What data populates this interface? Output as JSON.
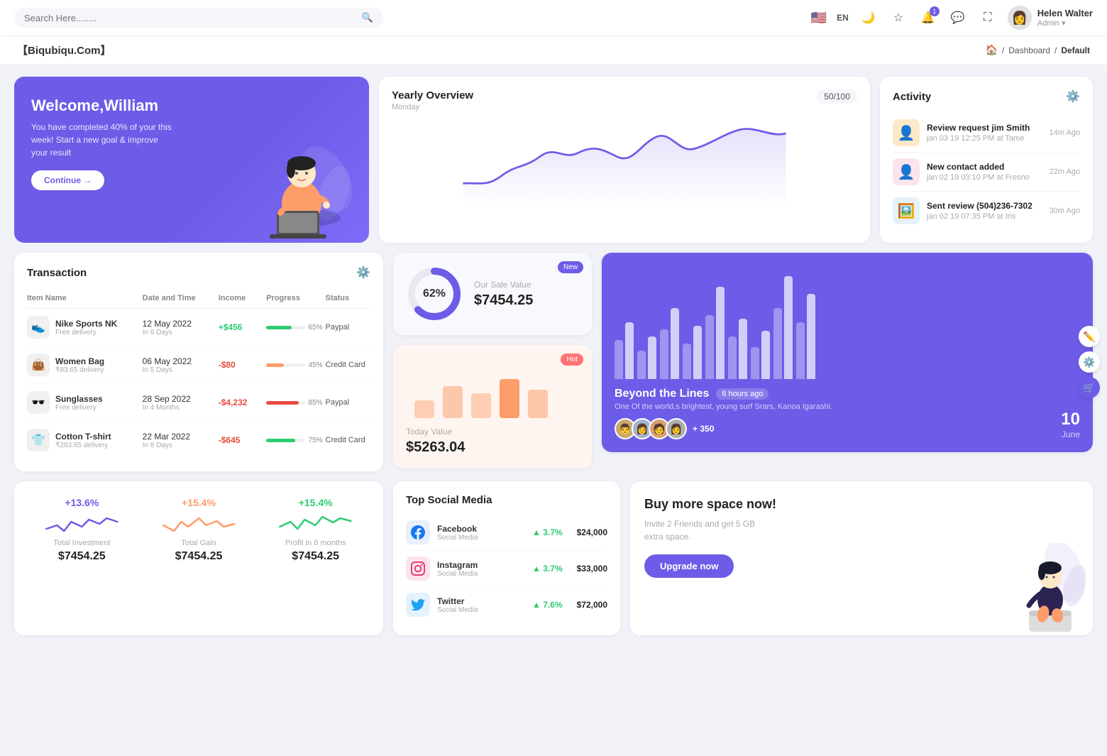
{
  "topnav": {
    "search_placeholder": "Search Here........",
    "lang": "EN",
    "notification_count": "1",
    "user": {
      "name": "Helen Walter",
      "role": "Admin"
    }
  },
  "breadcrumb": {
    "brand": "【Biqubiqu.Com】",
    "home": "🏠",
    "sep1": "/",
    "dashboard": "Dashboard",
    "sep2": "/",
    "current": "Default"
  },
  "welcome": {
    "greeting": "Welcome,William",
    "message": "You have completed 40% of your this week! Start a new goal & improve your result",
    "button": "Continue →"
  },
  "yearly_overview": {
    "title": "Yearly Overview",
    "subtitle": "Monday",
    "badge": "50/100"
  },
  "activity": {
    "title": "Activity",
    "items": [
      {
        "name": "Review request jim Smith",
        "sub": "jan 03 19 12:25 PM at Tame",
        "time": "14m Ago"
      },
      {
        "name": "New contact added",
        "sub": "jan 02 19 03:10 PM at Fresno",
        "time": "22m Ago"
      },
      {
        "name": "Sent review (504)236-7302",
        "sub": "jan 02 19 07:35 PM at Iris",
        "time": "30m Ago"
      }
    ]
  },
  "transaction": {
    "title": "Transaction",
    "columns": [
      "Item Name",
      "Date and Time",
      "Income",
      "Progress",
      "Status"
    ],
    "rows": [
      {
        "icon": "👟",
        "name": "Nike Sports NK",
        "sub": "Free delivery",
        "date": "12 May 2022",
        "date_sub": "In 6 Days",
        "income": "+$456",
        "income_type": "pos",
        "progress": 65,
        "progress_color": "#2ecc71",
        "status": "Paypal"
      },
      {
        "icon": "👜",
        "name": "Women Bag",
        "sub": "₹83.65 delivery",
        "date": "06 May 2022",
        "date_sub": "In 5 Days",
        "income": "-$80",
        "income_type": "neg",
        "progress": 45,
        "progress_color": "#fd7272",
        "status": "Credit Card"
      },
      {
        "icon": "🕶️",
        "name": "Sunglasses",
        "sub": "Free delivery",
        "date": "28 Sep 2022",
        "date_sub": "In 4 Months",
        "income": "-$4,232",
        "income_type": "neg",
        "progress": 85,
        "progress_color": "#e74c3c",
        "status": "Paypal"
      },
      {
        "icon": "👕",
        "name": "Cotton T-shirt",
        "sub": "₹283.65 delivery",
        "date": "22 Mar 2022",
        "date_sub": "In 8 Days",
        "income": "-$645",
        "income_type": "neg",
        "progress": 75,
        "progress_color": "#2ecc71",
        "status": "Credit Card"
      }
    ]
  },
  "sale_value": {
    "donut_pct": "62%",
    "badge": "New",
    "label": "Our Sale Value",
    "amount": "$7454.25"
  },
  "today_value": {
    "badge": "Hot",
    "label": "Today Value",
    "amount": "$5263.04"
  },
  "bar_chart": {
    "title": "Beyond the Lines",
    "time": "6 hours ago",
    "sub": "One Of the world,s brightest, young surf Srars, Kanoa Igarashi.",
    "plus": "+ 350",
    "date_num": "10",
    "date_month": "June"
  },
  "stats": [
    {
      "pct": "+13.6%",
      "label": "Total Investment",
      "value": "$7454.25",
      "color": "#6c5ce7"
    },
    {
      "pct": "+15.4%",
      "label": "Total Gain",
      "value": "$7454.25",
      "color": "#fd9d6a"
    },
    {
      "pct": "+15.4%",
      "label": "Profit in 6 months",
      "value": "$7454.25",
      "color": "#2ecc71"
    }
  ],
  "social": {
    "title": "Top Social Media",
    "items": [
      {
        "icon": "f",
        "name": "Facebook",
        "type": "Social Media",
        "pct": "3.7%",
        "amount": "$24,000",
        "color": "social-fb"
      },
      {
        "icon": "📷",
        "name": "Instagram",
        "type": "Social Media",
        "pct": "3.7%",
        "amount": "$33,000",
        "color": "social-ig"
      },
      {
        "icon": "🐦",
        "name": "Twitter",
        "type": "Social Media",
        "pct": "7.6%",
        "amount": "$72,000",
        "color": "social-tw"
      }
    ]
  },
  "upgrade": {
    "title": "Buy more space now!",
    "sub": "Invite 2 Friends and get 5 GB extra space.",
    "button": "Upgrade now"
  }
}
